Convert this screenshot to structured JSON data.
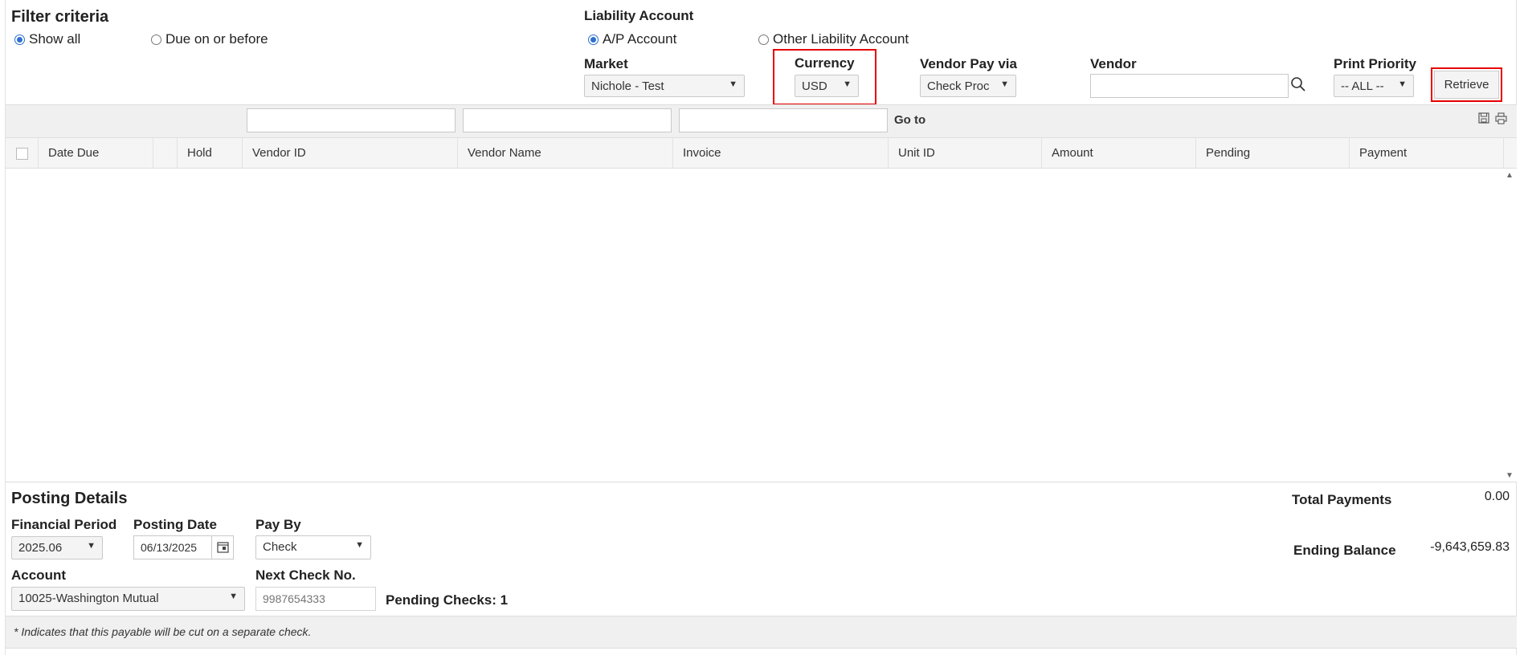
{
  "filter": {
    "title": "Filter criteria",
    "show_all": "Show all",
    "due_on_or_before": "Due on or before"
  },
  "liability": {
    "title": "Liability Account",
    "ap_account": "A/P Account",
    "other": "Other Liability Account"
  },
  "market": {
    "label": "Market",
    "value": "Nichole - Test"
  },
  "currency": {
    "label": "Currency",
    "value": "USD"
  },
  "vendor_pay_via": {
    "label": "Vendor Pay via",
    "value": "Check Proc"
  },
  "vendor": {
    "label": "Vendor",
    "value": ""
  },
  "print_priority": {
    "label": "Print Priority",
    "value": "-- ALL --"
  },
  "retrieve_label": "Retrieve",
  "goto_label": "Go to",
  "grid": {
    "columns": [
      "Date Due",
      "",
      "Hold",
      "Vendor ID",
      "Vendor Name",
      "Invoice",
      "Unit ID",
      "Amount",
      "Pending",
      "Payment"
    ]
  },
  "posting": {
    "title": "Posting Details",
    "financial_period": {
      "label": "Financial Period",
      "value": "2025.06"
    },
    "posting_date": {
      "label": "Posting Date",
      "value": "06/13/2025"
    },
    "pay_by": {
      "label": "Pay By",
      "value": "Check"
    },
    "account": {
      "label": "Account",
      "value": "10025-Washington Mutual"
    },
    "next_check": {
      "label": "Next Check No.",
      "placeholder": "9987654333"
    },
    "pending_checks": "Pending Checks: 1"
  },
  "totals": {
    "total_payments_label": "Total Payments",
    "total_payments_value": "0.00",
    "ending_balance_label": "Ending Balance",
    "ending_balance_value": "-9,643,659.83"
  },
  "footnote": "* Indicates that this payable will be cut on a separate check.",
  "colors": {
    "accent": "#2d6fd0",
    "highlight": "#e60000"
  }
}
